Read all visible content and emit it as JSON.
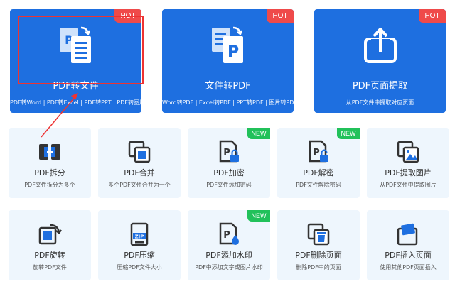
{
  "featured": [
    {
      "title": "PDF转文件",
      "sub": "PDF转Word | PDF转Excel | PDF转PPT | PDF转图片",
      "badge": "HOT"
    },
    {
      "title": "文件转PDF",
      "sub": "Word转PDF | Excel转PDF | PPT转PDF | 图片转PDF",
      "badge": "HOT"
    },
    {
      "title": "PDF页面提取",
      "sub": "从PDF文件中提取对应页面",
      "badge": "HOT"
    }
  ],
  "tools_row1": [
    {
      "title": "PDF拆分",
      "sub": "PDF文件拆分为多个",
      "badge": ""
    },
    {
      "title": "PDF合并",
      "sub": "多个PDF文件合并为一个",
      "badge": ""
    },
    {
      "title": "PDF加密",
      "sub": "PDF文件添加密码",
      "badge": "NEW"
    },
    {
      "title": "PDF解密",
      "sub": "PDF文件解除密码",
      "badge": "NEW"
    },
    {
      "title": "PDF提取图片",
      "sub": "从PDF文件中提取图片",
      "badge": ""
    }
  ],
  "tools_row2": [
    {
      "title": "PDF旋转",
      "sub": "旋转PDF文件",
      "badge": ""
    },
    {
      "title": "PDF压缩",
      "sub": "压缩PDF文件大小",
      "badge": "",
      "icon_label": "ZIP"
    },
    {
      "title": "PDF添加水印",
      "sub": "PDF中添加文字或图片水印",
      "badge": "NEW"
    },
    {
      "title": "PDF删除页面",
      "sub": "删除PDF中的页面",
      "badge": ""
    },
    {
      "title": "PDF插入页面",
      "sub": "使用其他PDF页面插入",
      "badge": ""
    }
  ],
  "colors": {
    "primary": "#1e6fe0",
    "hot": "#ef4a4a",
    "new": "#21c15a",
    "card_bg": "#eef6fd",
    "annotation": "#e33333"
  }
}
